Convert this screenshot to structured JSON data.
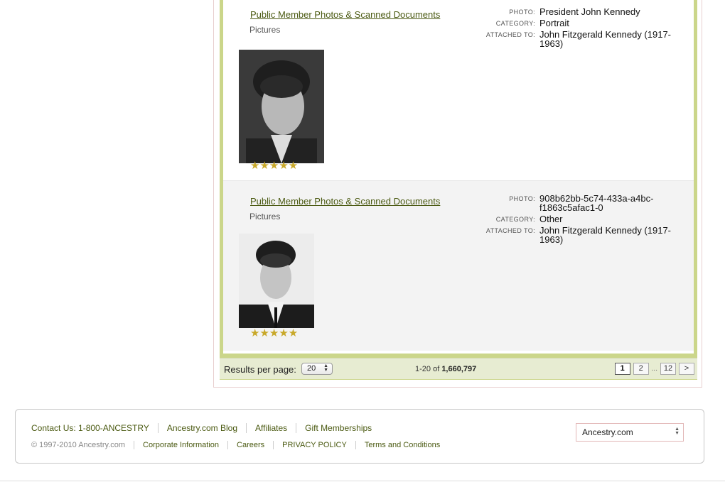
{
  "records": [
    {
      "title": "Public Member Photos & Scanned Documents",
      "subtitle": "Pictures",
      "rating_stars": "★★★★★",
      "rating": 5,
      "meta": [
        {
          "label": "PHOTO:",
          "value": "President John Kennedy"
        },
        {
          "label": "CATEGORY:",
          "value": "Portrait"
        },
        {
          "label": "ATTACHED TO:",
          "value": "John Fitzgerald Kennedy (1917-1963)"
        }
      ]
    },
    {
      "title": "Public Member Photos & Scanned Documents",
      "subtitle": "Pictures",
      "rating_stars": "★★★★★",
      "rating": 5,
      "meta": [
        {
          "label": "PHOTO:",
          "value": "908b62bb-5c74-433a-a4bc-f1863c5afac1-0"
        },
        {
          "label": "CATEGORY:",
          "value": "Other"
        },
        {
          "label": "ATTACHED TO:",
          "value": "John Fitzgerald Kennedy (1917-1963)"
        }
      ]
    }
  ],
  "pager": {
    "results_per_page_label": "Results per page:",
    "results_per_page_value": "20",
    "range_prefix": "1-20 of ",
    "range_total": "1,660,797",
    "pages": [
      "1",
      "2",
      "12"
    ],
    "current_page": "1",
    "ellipsis": "...",
    "next": ">"
  },
  "footer": {
    "row1": [
      "Contact Us: 1-800-ANCESTRY",
      "Ancestry.com Blog",
      "Affiliates",
      "Gift Memberships"
    ],
    "copyright": "© 1997-2010 Ancestry.com",
    "row2": [
      "Corporate Information",
      "Careers",
      "PRIVACY POLICY",
      "Terms and Conditions"
    ],
    "site_select": "Ancestry.com"
  },
  "colors": {
    "panel_green": "#cbd68a",
    "link_green": "#4b5a12",
    "star_gold": "#c8a829"
  }
}
